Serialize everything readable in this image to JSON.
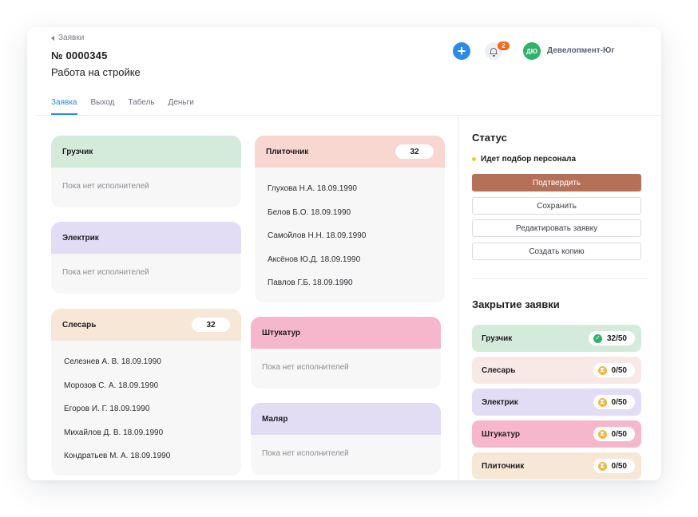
{
  "header": {
    "back_label": "Заявки",
    "order_number": "№ 0000345",
    "order_title": "Работа на стройке",
    "add_symbol": "+",
    "notification_count": "2",
    "avatar_initials": "ДЮ",
    "company_name": "Девелопмент-Юг"
  },
  "tabs": [
    {
      "label": "Заявка",
      "active": true
    },
    {
      "label": "Выход",
      "active": false
    },
    {
      "label": "Табель",
      "active": false
    },
    {
      "label": "Деньги",
      "active": false
    }
  ],
  "roles": {
    "loader": {
      "name": "Грузчик",
      "empty": "Пока нет исполнителей",
      "color": "#d4ebdc"
    },
    "electrician": {
      "name": "Электрик",
      "empty": "Пока нет исполнителей",
      "color": "#e2ddf5"
    },
    "locksmith": {
      "name": "Слесарь",
      "count": "32",
      "color": "#f6e7d6",
      "workers": [
        "Селезнев А. В. 18.09.1990",
        "Морозов С. А. 18.09.1990",
        "Егоров И. Г. 18.09.1990",
        "Михайлов Д. В. 18.09.1990",
        "Кондратьев М. А. 18.09.1990"
      ]
    },
    "tiler": {
      "name": "Плиточник",
      "count": "32",
      "color": "#f7d7cf",
      "workers": [
        "Глухова Н.А. 18.09.1990",
        "Белов Б.О. 18.09.1990",
        "Самойлов Н.Н. 18.09.1990",
        "Аксёнов Ю.Д. 18.09.1990",
        "Павлов Г.Б. 18.09.1990"
      ]
    },
    "plasterer": {
      "name": "Штукатур",
      "empty": "Пока нет исполнителей",
      "color": "#f6b7cd"
    },
    "painter": {
      "name": "Маляр",
      "empty": "Пока нет исполнителей",
      "color": "#e2ddf5"
    }
  },
  "status": {
    "title": "Статус",
    "state": "Идет подбор персонала",
    "confirm_label": "Подтвердить",
    "save_label": "Сохранить",
    "edit_label": "Редактировать заявку",
    "copy_label": "Создать копию"
  },
  "closing": {
    "title": "Закрытие заявки",
    "rows": [
      {
        "name": "Грузчик",
        "value": "32/50",
        "done": true,
        "color": "#d4ebdc"
      },
      {
        "name": "Слесарь",
        "value": "0/50",
        "done": false,
        "color": "#f8e9e6"
      },
      {
        "name": "Электрик",
        "value": "0/50",
        "done": false,
        "color": "#e2ddf5"
      },
      {
        "name": "Штукатур",
        "value": "0/50",
        "done": false,
        "color": "#f6b7cd"
      },
      {
        "name": "Плиточник",
        "value": "0/50",
        "done": false,
        "color": "#f6e7d6"
      }
    ]
  }
}
